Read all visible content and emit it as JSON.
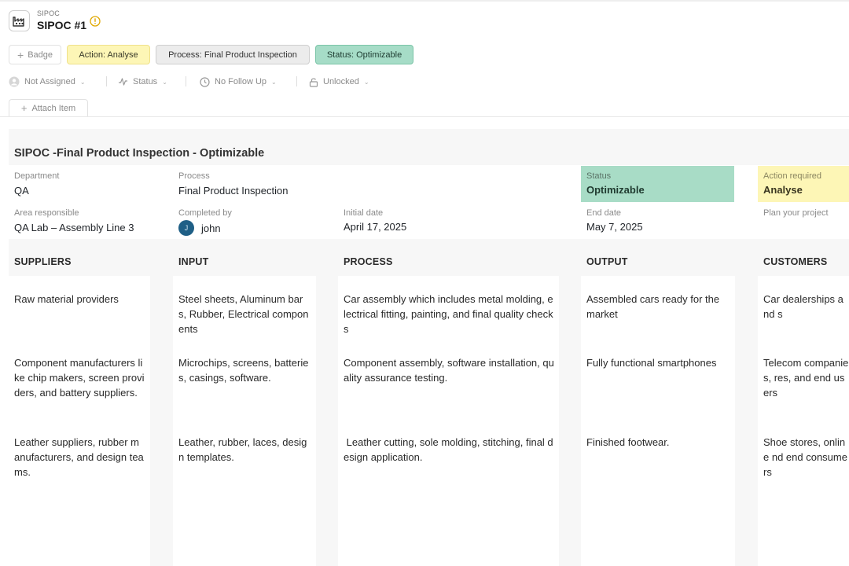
{
  "header": {
    "eyebrow": "SIPOC",
    "title": "SIPOC #1",
    "app_icon": "factory-icon",
    "warning_icon": "warning-circle-icon"
  },
  "badges": {
    "add_label": "Badge",
    "action": "Action: Analyse",
    "process": "Process: Final Product Inspection",
    "status": "Status: Optimizable"
  },
  "meta": {
    "assignee": "Not Assigned",
    "status": "Status",
    "follow_up": "No Follow Up",
    "lock": "Unlocked"
  },
  "attach_label": "Attach Item",
  "board": {
    "title": "SIPOC -Final Product Inspection - Optimizable",
    "department": {
      "label": "Department",
      "value": "QA"
    },
    "process": {
      "label": "Process",
      "value": "Final Product Inspection"
    },
    "status": {
      "label": "Status",
      "value": "Optimizable"
    },
    "action": {
      "label": "Action required",
      "value": "Analyse"
    },
    "area": {
      "label": "Area responsible",
      "value": "QA Lab – Assembly Line 3"
    },
    "completed_by": {
      "label": "Completed by",
      "initial": "J",
      "value": "john"
    },
    "initial_date": {
      "label": "Initial date",
      "value": "April 17, 2025"
    },
    "end_date": {
      "label": "End date",
      "value": "May 7, 2025"
    },
    "plan": {
      "label": "Plan your project"
    }
  },
  "columns": {
    "suppliers": {
      "title": "SUPPLIERS",
      "items": [
        "Raw material providers",
        "Component manufacturers like chip makers, screen providers, and battery suppliers.",
        "Leather suppliers, rubber manufacturers, and design teams."
      ]
    },
    "input": {
      "title": "INPUT",
      "items": [
        "Steel sheets, Aluminum bars, Rubber, Electrical components",
        "Microchips, screens, batteries, casings, software.",
        "Leather, rubber, laces, design templates."
      ]
    },
    "process": {
      "title": "PROCESS",
      "items": [
        "Car assembly which includes metal molding, electrical fitting, painting, and final quality checks",
        "Component assembly, software installation, quality assurance testing.",
        " Leather cutting, sole molding, stitching, final design application."
      ]
    },
    "output": {
      "title": "OUTPUT",
      "items": [
        "Assembled cars ready for the market",
        "Fully functional smartphones",
        "Finished footwear."
      ]
    },
    "customers": {
      "title": "CUSTOMERS",
      "items": [
        "Car dealerships and s",
        "Telecom companies, res, and end users",
        "Shoe stores, online nd end consumers"
      ]
    }
  },
  "colors": {
    "status_green": "#a8dcc6",
    "action_yellow": "#fdf6b6",
    "avatar_blue": "#1f5f86"
  }
}
